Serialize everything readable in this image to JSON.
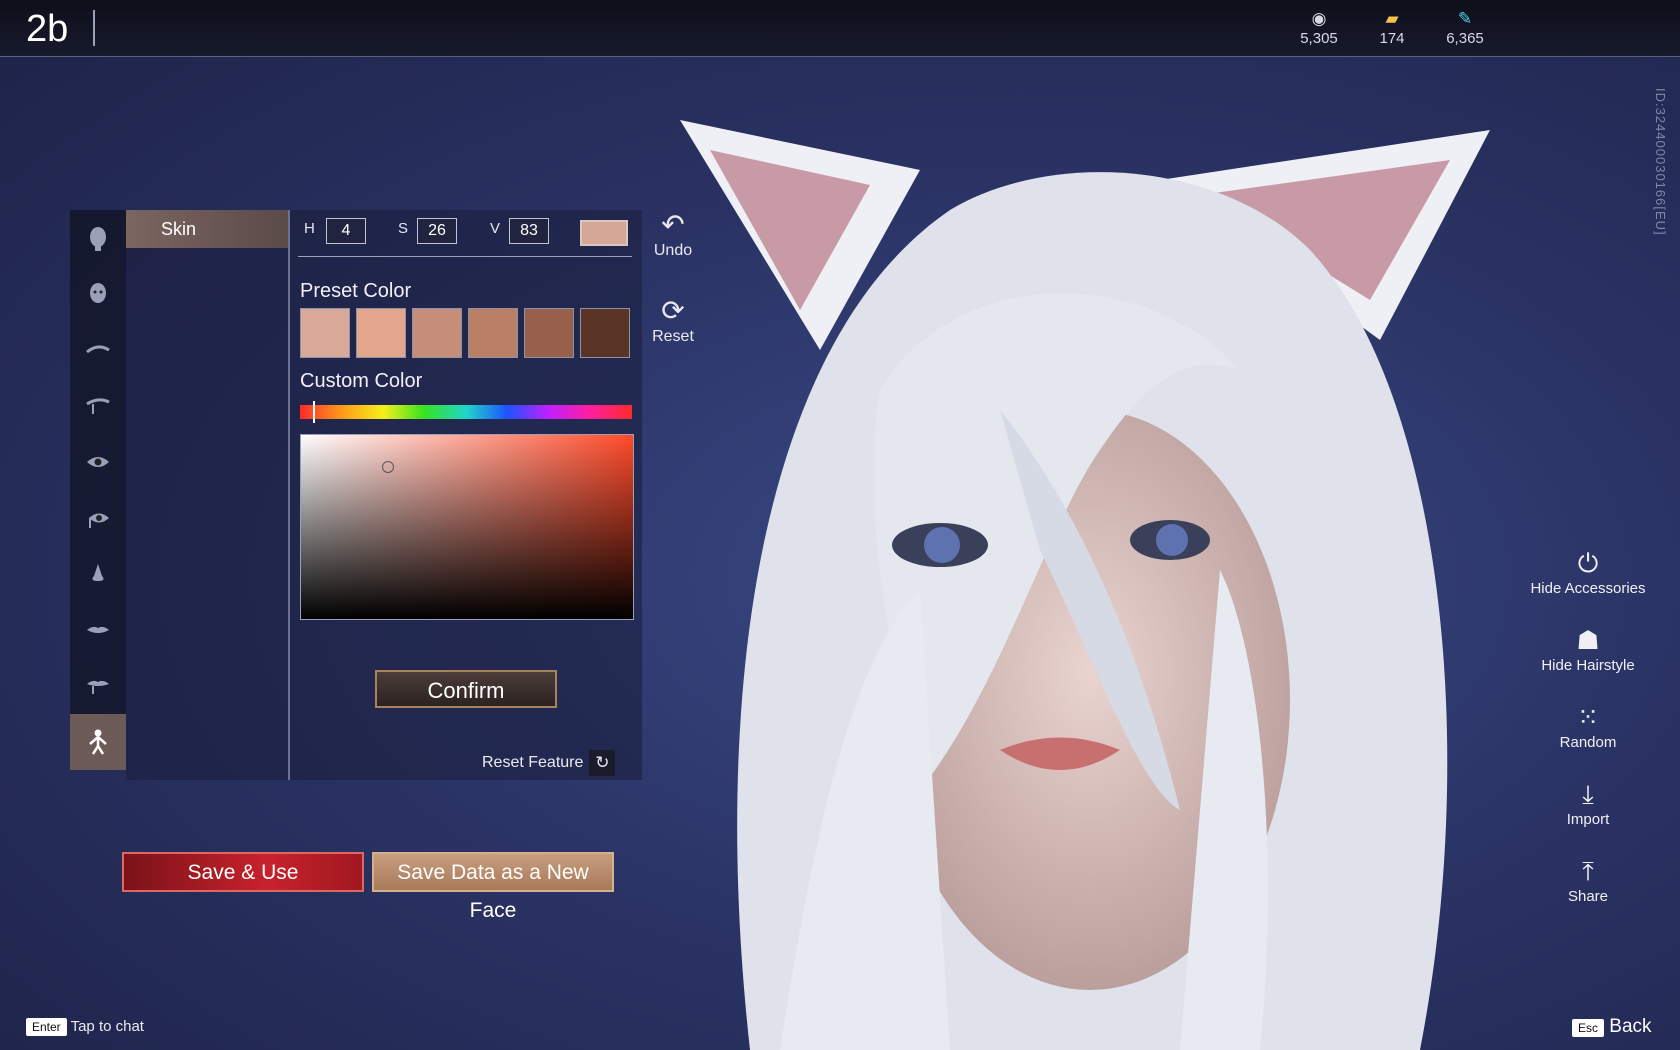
{
  "header": {
    "title": "2b",
    "currencies": [
      {
        "icon": "silver-coin-icon",
        "value": "5,305"
      },
      {
        "icon": "gold-ticket-icon",
        "value": "174"
      },
      {
        "icon": "feather-icon",
        "value": "6,365"
      }
    ],
    "player_id": "ID:324400030166[EU]"
  },
  "editor": {
    "categories": [
      {
        "name": "face-shape",
        "icon": "head-front-icon"
      },
      {
        "name": "face-profile",
        "icon": "head-detail-icon"
      },
      {
        "name": "eyebrows",
        "icon": "eyebrow-icon"
      },
      {
        "name": "eyebrow-detail",
        "icon": "eyebrow-detail-icon"
      },
      {
        "name": "eyes",
        "icon": "eye-icon"
      },
      {
        "name": "eye-detail",
        "icon": "eye-detail-icon"
      },
      {
        "name": "nose",
        "icon": "nose-icon"
      },
      {
        "name": "mouth",
        "icon": "lips-icon"
      },
      {
        "name": "lips-detail",
        "icon": "lips-detail-icon"
      },
      {
        "name": "body",
        "icon": "body-icon",
        "active": true
      }
    ],
    "sub_item": "Skin",
    "hsv": {
      "h_label": "H",
      "h": "4",
      "s_label": "S",
      "s": "26",
      "v_label": "V",
      "v": "83",
      "swatch_color": "#d4a796"
    },
    "preset_label": "Preset Color",
    "presets": [
      "#d9a898",
      "#e3a58c",
      "#c68d78",
      "#bb7f66",
      "#98604a",
      "#5a3424"
    ],
    "custom_label": "Custom Color",
    "hue_position": 0.04,
    "sv_saturation": 0.26,
    "sv_value": 0.83,
    "confirm_label": "Confirm",
    "reset_feature_label": "Reset Feature"
  },
  "tools": {
    "undo_label": "Undo",
    "reset_label": "Reset"
  },
  "actions": {
    "save_use_label": "Save & Use",
    "save_new_label": "Save Data as a New Face"
  },
  "right_tools": [
    {
      "label": "Hide Accessories",
      "icon": "accessory-icon"
    },
    {
      "label": "Hide Hairstyle",
      "icon": "hairstyle-icon"
    },
    {
      "label": "Random",
      "icon": "dice-icon"
    },
    {
      "label": "Import",
      "icon": "download-icon"
    },
    {
      "label": "Share",
      "icon": "upload-icon"
    }
  ],
  "footer": {
    "chat_key": "Enter",
    "chat_label": "Tap to chat",
    "back_key": "Esc",
    "back_label": "Back"
  },
  "colors": {
    "accent_gold": "#a8835a",
    "save_red": "#c8222c"
  }
}
